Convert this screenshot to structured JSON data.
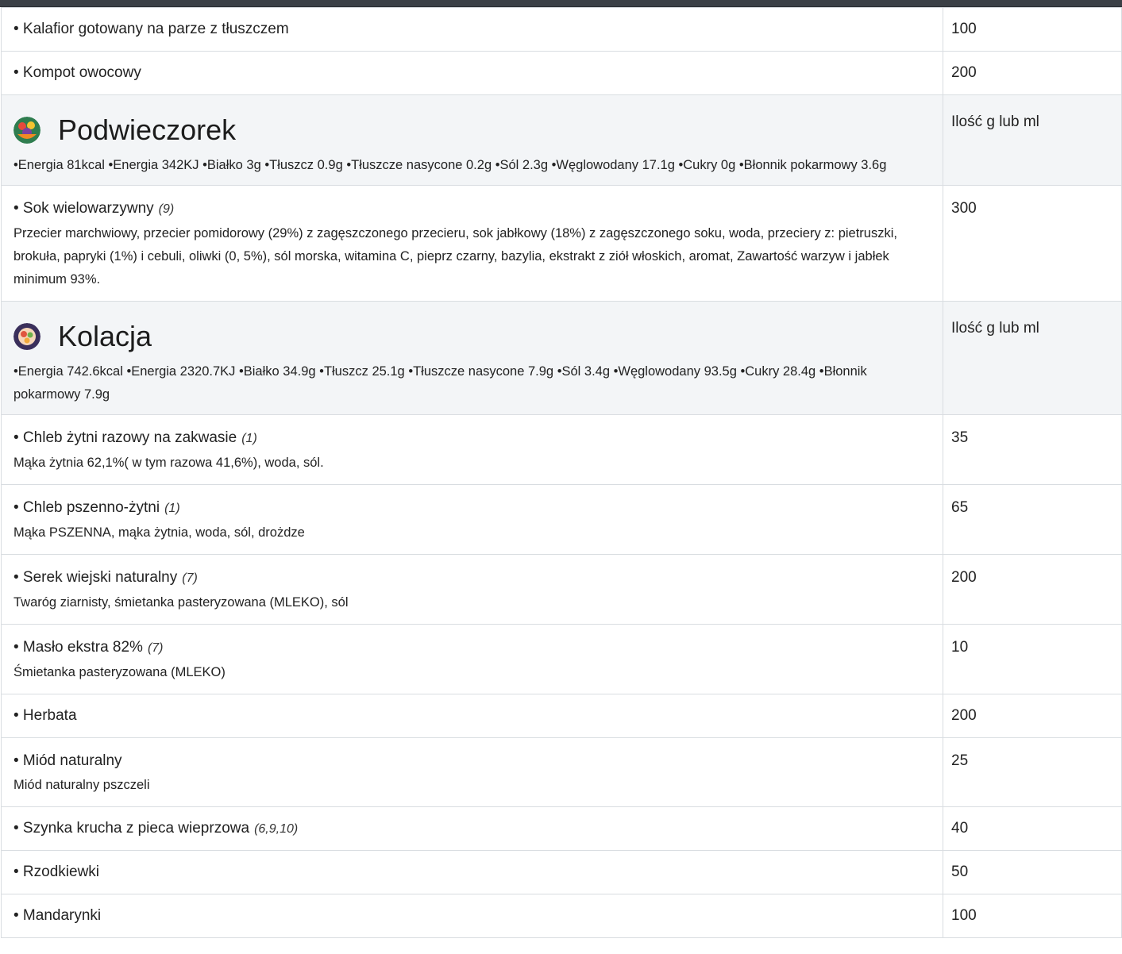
{
  "rows": {
    "r1": {
      "name": "• Kalafior gotowany na parze z tłuszczem",
      "qty": "100"
    },
    "r2": {
      "name": "• Kompot owocowy",
      "qty": "200"
    },
    "meal1": {
      "title": "Podwieczorek",
      "qty_header": "Ilość g lub ml",
      "nutrition": "•Energia 81kcal •Energia 342KJ •Białko 3g •Tłuszcz 0.9g •Tłuszcze nasycone 0.2g •Sól 2.3g •Węglowodany 17.1g •Cukry 0g •Błonnik pokarmowy 3.6g",
      "icon": "fruit-bowl-icon"
    },
    "r3": {
      "name": "• Sok wielowarzywny",
      "allergens": "(9)",
      "desc": "Przecier marchwiowy, przecier pomidorowy (29%) z zagęszczonego przecieru, sok jabłkowy (18%) z zagęszczonego soku, woda, przeciery z: pietruszki, brokuła, papryki (1%) i cebuli, oliwki (0, 5%), sól morska, witamina C, pieprz czarny, bazylia, ekstrakt z ziół włoskich, aromat, Zawartość warzyw i jabłek minimum 93%.",
      "qty": "300"
    },
    "meal2": {
      "title": "Kolacja",
      "qty_header": "Ilość g lub ml",
      "nutrition": "•Energia 742.6kcal •Energia 2320.7KJ •Białko 34.9g •Tłuszcz 25.1g •Tłuszcze nasycone 7.9g •Sól 3.4g •Węglowodany 93.5g •Cukry 28.4g •Błonnik pokarmowy 7.9g",
      "icon": "dinner-plate-icon"
    },
    "r4": {
      "name": "• Chleb żytni razowy na zakwasie",
      "allergens": "(1)",
      "desc": "Mąka żytnia 62,1%( w tym razowa 41,6%), woda, sól.",
      "qty": "35"
    },
    "r5": {
      "name": "• Chleb pszenno-żytni",
      "allergens": "(1)",
      "desc": "Mąka PSZENNA, mąka żytnia, woda, sól, drożdze",
      "qty": "65"
    },
    "r6": {
      "name": "• Serek wiejski naturalny",
      "allergens": "(7)",
      "desc": "Twaróg ziarnisty, śmietanka pasteryzowana (MLEKO), sól",
      "qty": "200"
    },
    "r7": {
      "name": "• Masło ekstra 82%",
      "allergens": "(7)",
      "desc": "Śmietanka pasteryzowana (MLEKO)",
      "qty": "10"
    },
    "r8": {
      "name": "• Herbata",
      "qty": "200"
    },
    "r9": {
      "name": "• Miód naturalny",
      "desc": "Miód naturalny pszczeli",
      "qty": "25"
    },
    "r10": {
      "name": "• Szynka krucha z pieca wieprzowa",
      "allergens": "(6,9,10)",
      "qty": "40"
    },
    "r11": {
      "name": "• Rzodkiewki",
      "qty": "50"
    },
    "r12": {
      "name": "• Mandarynki",
      "qty": "100"
    }
  }
}
